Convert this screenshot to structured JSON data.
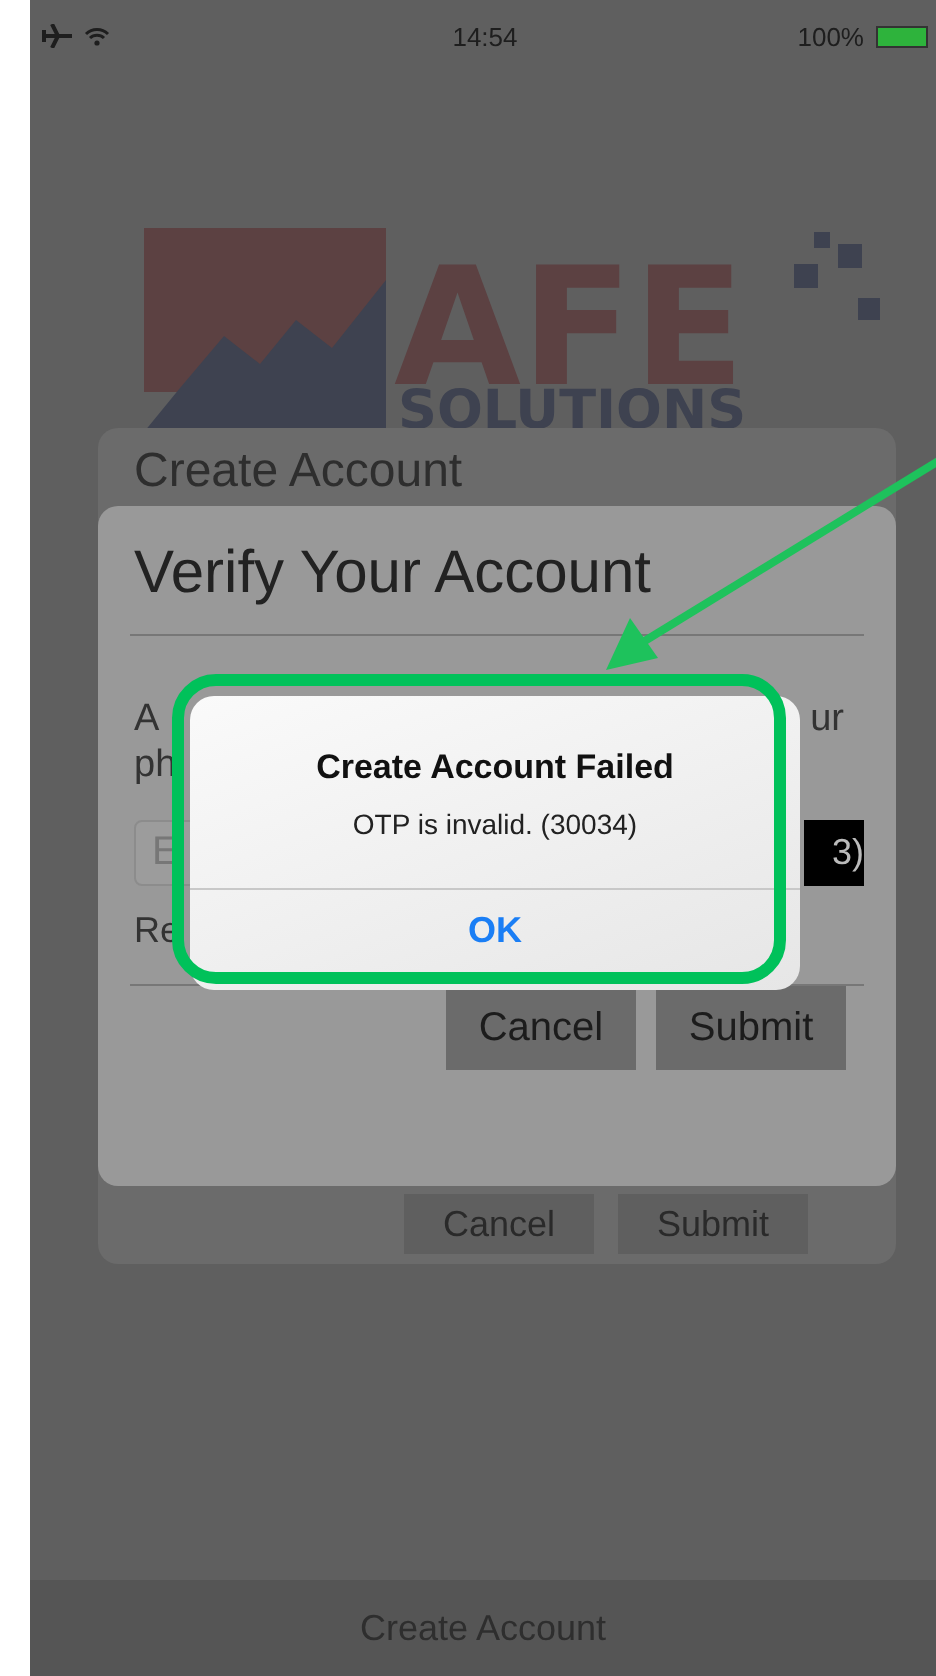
{
  "status_bar": {
    "time": "14:54",
    "battery": "100%",
    "airplane_mode": true
  },
  "logo": {
    "name": "AFE",
    "tagline": "SOLUTIONS"
  },
  "create_account_dialog": {
    "title": "Create Account",
    "buttons": [
      {
        "label": "Cancel"
      },
      {
        "label": "Submit"
      }
    ]
  },
  "verify_dialog": {
    "title": "Verify Your Account",
    "line_1_start": "A",
    "line_1_end": "ur",
    "line_2_start": "ph",
    "field_placeholder": "E",
    "field_button": "3)",
    "note_start": "Re",
    "buttons": [
      {
        "label": "Cancel"
      },
      {
        "label": "Submit"
      }
    ]
  },
  "alert": {
    "title": "Create Account Failed",
    "message": "OTP is invalid. (30034)",
    "button": "OK",
    "highlighted": true
  },
  "bottom_bar": {
    "label": "Create Account"
  }
}
